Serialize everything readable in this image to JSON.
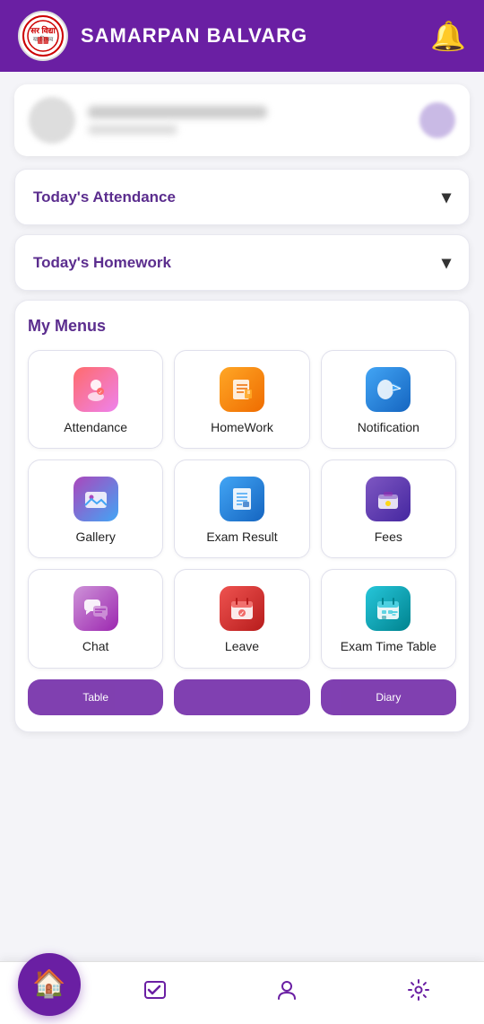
{
  "header": {
    "title": "SAMARPAN BALVARG",
    "bell_label": "notifications-bell"
  },
  "attendance_dropdown": {
    "label": "Today's Attendance",
    "arrow": "▾"
  },
  "homework_dropdown": {
    "label": "Today's Homework",
    "arrow": "▾"
  },
  "menus": {
    "section_title": "My Menus",
    "items": [
      {
        "id": "attendance",
        "label": "Attendance",
        "icon": "👤"
      },
      {
        "id": "homework",
        "label": "HomeWork",
        "icon": "📖"
      },
      {
        "id": "notification",
        "label": "Notification",
        "icon": "📢"
      },
      {
        "id": "gallery",
        "label": "Gallery",
        "icon": "🖼️"
      },
      {
        "id": "exam-result",
        "label": "Exam Result",
        "icon": "📋"
      },
      {
        "id": "fees",
        "label": "Fees",
        "icon": "👛"
      },
      {
        "id": "chat",
        "label": "Chat",
        "icon": "💬"
      },
      {
        "id": "leave",
        "label": "Leave",
        "icon": "📅"
      },
      {
        "id": "exam-timetable",
        "label": "Exam Time Table",
        "icon": "🗓️"
      }
    ],
    "partial_items": [
      {
        "id": "partial-1",
        "label": "Table"
      },
      {
        "id": "partial-2",
        "label": ""
      },
      {
        "id": "partial-3",
        "label": "Diary"
      }
    ]
  },
  "bottom_nav": {
    "home_icon": "🏠",
    "items": [
      {
        "id": "attendance-nav",
        "icon": "✔️",
        "label": ""
      },
      {
        "id": "profile-nav",
        "icon": "👤",
        "label": ""
      },
      {
        "id": "settings-nav",
        "icon": "⚙️",
        "label": ""
      }
    ]
  }
}
